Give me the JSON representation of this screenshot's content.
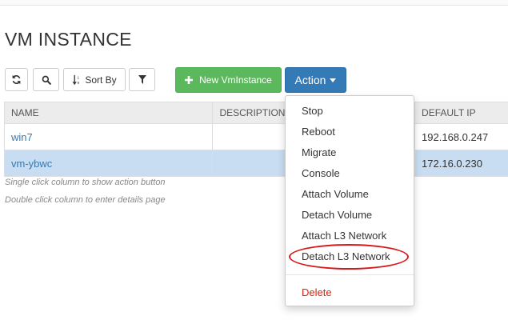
{
  "page": {
    "title": "VM INSTANCE"
  },
  "toolbar": {
    "sort_label": "Sort By",
    "new_label": "New VmInstance",
    "action_label": "Action"
  },
  "table": {
    "headers": [
      "NAME",
      "DESCRIPTION",
      "DEFAULT IP"
    ],
    "rows": [
      {
        "name": "win7",
        "description": "",
        "ip": "192.168.0.247",
        "selected": false
      },
      {
        "name": "vm-ybwc",
        "description": "",
        "ip": "172.16.0.230",
        "selected": true
      }
    ]
  },
  "hints": [
    "Single click column to show action button",
    "Double click column to enter details page"
  ],
  "action_menu": {
    "items": [
      "Stop",
      "Reboot",
      "Migrate",
      "Console",
      "Attach Volume",
      "Detach Volume",
      "Attach L3 Network",
      "Detach L3 Network"
    ],
    "delete_label": "Delete"
  },
  "colors": {
    "primary": "#337ab7",
    "success": "#5cb85c",
    "danger": "#d9230f",
    "selected_row": "#c8ddf1",
    "annotation": "#d7191c"
  },
  "icons": [
    "refresh-icon",
    "search-icon",
    "sort-icon",
    "filter-icon",
    "plus-icon",
    "caret-down-icon"
  ]
}
